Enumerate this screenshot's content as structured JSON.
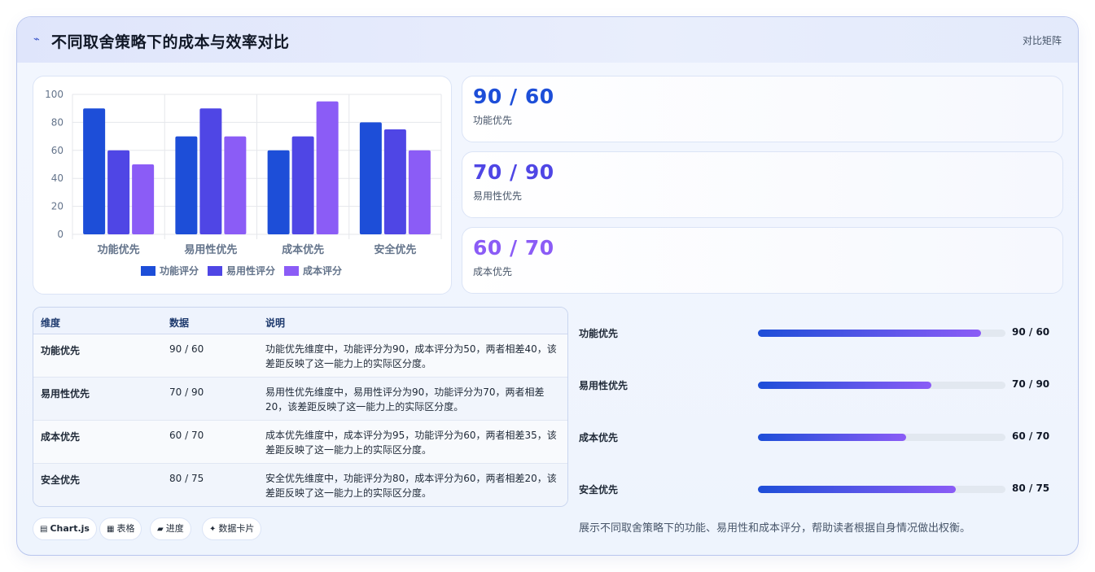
{
  "header": {
    "icon": "lightning-icon",
    "title": "不同取舍策略下的成本与效率对比",
    "tag": "对比矩阵"
  },
  "colors": {
    "func": "#1d4ed8",
    "usab": "#4f46e5",
    "cost": "#8b5cf6"
  },
  "chart_data": {
    "type": "bar",
    "categories": [
      "功能优先",
      "易用性优先",
      "成本优先",
      "安全优先"
    ],
    "series": [
      {
        "name": "功能评分",
        "values": [
          90,
          70,
          60,
          80
        ]
      },
      {
        "name": "易用性评分",
        "values": [
          60,
          90,
          70,
          75
        ]
      },
      {
        "name": "成本评分",
        "values": [
          50,
          70,
          95,
          60
        ]
      }
    ],
    "yticks": [
      "0",
      "20",
      "40",
      "60",
      "80",
      "100"
    ],
    "ylim": [
      0,
      100
    ],
    "grid": true,
    "legend": "bottom"
  },
  "stats": [
    {
      "value": "90 / 60",
      "label": "功能优先",
      "color": "#1d4ed8"
    },
    {
      "value": "70 / 90",
      "label": "易用性优先",
      "color": "#4f46e5"
    },
    {
      "value": "60 / 70",
      "label": "成本优先",
      "color": "#8b5cf6"
    }
  ],
  "table": {
    "headers": [
      "维度",
      "数据",
      "说明"
    ],
    "rows": [
      {
        "dim": "功能优先",
        "data": "90 / 60",
        "desc": "功能优先维度中，功能评分为90，成本评分为50，两者相差40，该差距反映了这一能力上的实际区分度。"
      },
      {
        "dim": "易用性优先",
        "data": "70 / 90",
        "desc": "易用性优先维度中，易用性评分为90，功能评分为70，两者相差20，该差距反映了这一能力上的实际区分度。"
      },
      {
        "dim": "成本优先",
        "data": "60 / 70",
        "desc": "成本优先维度中，成本评分为95，功能评分为60，两者相差35，该差距反映了这一能力上的实际区分度。"
      },
      {
        "dim": "安全优先",
        "data": "80 / 75",
        "desc": "安全优先维度中，功能评分为80，成本评分为60，两者相差20，该差距反映了这一能力上的实际区分度。"
      }
    ]
  },
  "progress": [
    {
      "label": "功能优先",
      "value": "90 / 60",
      "fraction": 0.9
    },
    {
      "label": "易用性优先",
      "value": "70 / 90",
      "fraction": 0.7
    },
    {
      "label": "成本优先",
      "value": "60 / 70",
      "fraction": 0.6
    },
    {
      "label": "安全优先",
      "value": "80 / 75",
      "fraction": 0.8
    }
  ],
  "chips": [
    {
      "icon": "chart-icon",
      "label": "Chart.js"
    },
    {
      "icon": "table-icon",
      "label": "表格"
    },
    {
      "icon": "progress-icon",
      "label": "进度"
    },
    {
      "icon": "sparkle-icon",
      "label": "数据卡片"
    }
  ],
  "note": "展示不同取舍策略下的功能、易用性和成本评分，帮助读者根据自身情况做出权衡。"
}
